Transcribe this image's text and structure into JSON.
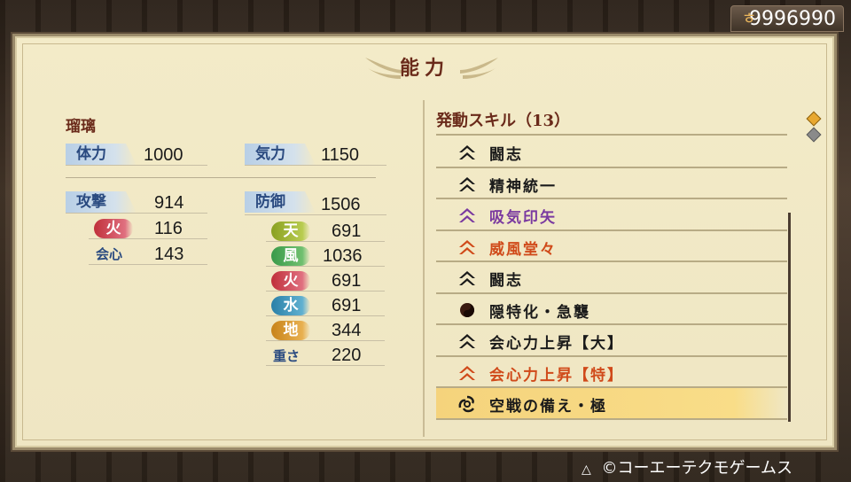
{
  "money": {
    "amount": "9996990",
    "icon": "coin-icon"
  },
  "panel": {
    "title": "能力"
  },
  "left": {
    "name": "瑠璃",
    "stamina": {
      "label": "体力",
      "value": "1000"
    },
    "ki": {
      "label": "気力",
      "value": "1150"
    },
    "attack": {
      "label": "攻撃",
      "value": "914"
    },
    "defense": {
      "label": "防御",
      "value": "1506"
    },
    "fire_atk": {
      "label": "火",
      "value": "116"
    },
    "crit": {
      "label": "会心",
      "value": "143"
    },
    "heaven": {
      "label": "天",
      "value": "691"
    },
    "wind": {
      "label": "風",
      "value": "1036"
    },
    "fire_def": {
      "label": "火",
      "value": "691"
    },
    "water": {
      "label": "水",
      "value": "691"
    },
    "earth": {
      "label": "地",
      "value": "344"
    },
    "weight": {
      "label": "重さ",
      "value": "220"
    }
  },
  "skills": {
    "header": "発動スキル（13）",
    "items": [
      {
        "name": "闘志",
        "color": "#1a1a1a",
        "icon": "chevron-icon"
      },
      {
        "name": "精神統一",
        "color": "#1a1a1a",
        "icon": "chevron-icon"
      },
      {
        "name": "吸気印矢",
        "color": "#7a3aa0",
        "icon": "chevron-icon"
      },
      {
        "name": "威風堂々",
        "color": "#d04a1a",
        "icon": "chevron-icon"
      },
      {
        "name": "闘志",
        "color": "#1a1a1a",
        "icon": "chevron-icon"
      },
      {
        "name": "隠特化・急襲",
        "color": "#1a1a1a",
        "icon": "tomoe-icon"
      },
      {
        "name": "会心力上昇【大】",
        "color": "#1a1a1a",
        "icon": "chevron-icon"
      },
      {
        "name": "会心力上昇【特】",
        "color": "#d04a1a",
        "icon": "chevron-icon"
      },
      {
        "name": "空戦の備え・極",
        "color": "#1a1a1a",
        "icon": "triskelion-icon"
      }
    ]
  },
  "footer": {
    "copyright": "©コーエーテクモゲームス",
    "button_icon": "triangle-button-icon"
  },
  "colors": {
    "fire": "#c0303a",
    "heaven": "#8aa020",
    "wind": "#3a9a4a",
    "water": "#2a80a8",
    "earth": "#c8841a"
  }
}
